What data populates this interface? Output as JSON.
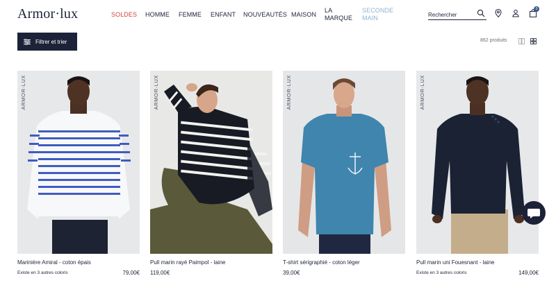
{
  "header": {
    "logo": "Armor·lux",
    "nav": [
      {
        "label": "SOLDES"
      },
      {
        "label": "HOMME"
      },
      {
        "label": "FEMME"
      },
      {
        "label": "ENFANT"
      },
      {
        "label": "NOUVEAUTÉS"
      },
      {
        "label": "MAISON"
      },
      {
        "label": "LA MARQUE"
      },
      {
        "label": "SECONDE MAIN"
      }
    ],
    "search_placeholder": "Rechercher",
    "cart_count": "0"
  },
  "toolbar": {
    "filter_label": "Filtrer et trier",
    "product_count": "862 produits"
  },
  "products": [
    {
      "brand": "ARMOR·LUX",
      "name": "Marinière Amiral - coton épais",
      "colors": "Existe en 3  autres coloris",
      "price": "79,00€"
    },
    {
      "brand": "ARMOR·LUX",
      "name": "Pull marin rayé Paimpol - laine",
      "colors": "",
      "price": "119,00€"
    },
    {
      "brand": "ARMOR·LUX",
      "name": "T-shirt sérigraphié - coton léger",
      "colors": "",
      "price": "39,00€"
    },
    {
      "brand": "ARMOR·LUX",
      "name": "Pull marin uni Fouesnant - laine",
      "colors": "Existe en 3  autres coloris",
      "price": "149,00€"
    }
  ],
  "colors": {
    "brand_navy": "#1c2338",
    "sale_red": "#d0443e",
    "muted_blue": "#8fb4cf"
  }
}
